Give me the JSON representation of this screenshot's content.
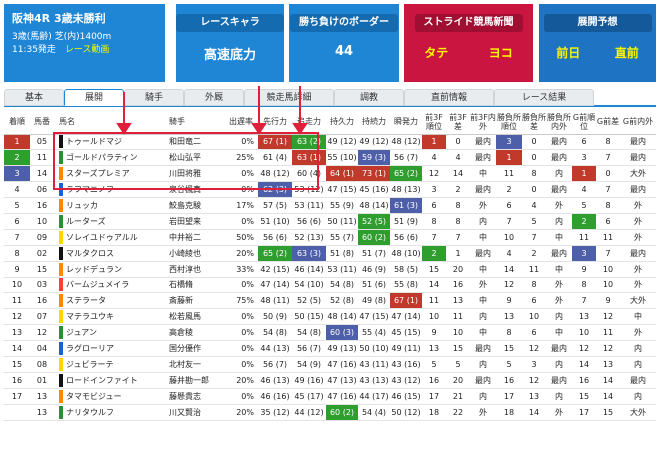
{
  "race": {
    "title": "阪神4R 3歳未勝利",
    "line1": "3歳(馬齢)  芝(内)1400m",
    "post_time": "11:35発走",
    "video": "レース動画"
  },
  "race_chara": {
    "header": "レースキャラ",
    "value": "高速底力"
  },
  "border": {
    "header": "勝ち負けのボーダー",
    "value": "44"
  },
  "stride": {
    "header": "ストライド競馬新聞",
    "left": "タテ",
    "right": "ヨコ"
  },
  "tenkai": {
    "header": "展開予想",
    "left": "前日",
    "right": "直前"
  },
  "tabs": [
    "基本",
    "展開",
    "騎手",
    "外厩",
    "競走馬詳細",
    "調教",
    "直前情報",
    "レース結果"
  ],
  "active_tab": "展開",
  "columns": [
    "着順",
    "馬番",
    "馬名",
    "騎手",
    "出遅率",
    "先行力",
    "追走力",
    "持久力",
    "持続力",
    "瞬発力",
    "前3F順位",
    "前3F差",
    "前3F内外",
    "勝負所順位",
    "勝負所差",
    "勝負所内外",
    "G前順位",
    "G前差",
    "G前内外"
  ],
  "rows": [
    {
      "rank": "1",
      "no": "05",
      "name": "トゥールドマジ",
      "gate": "#111111",
      "jockey": "和田竜二",
      "late": "0%",
      "senko": "67 (1)",
      "tsuiso": "63 (2)",
      "jikyu": "49 (12)",
      "jizoku": "49 (12)",
      "shunpatsu": "48 (12)",
      "f3r": "1",
      "f3d": "0",
      "f3s": "最内",
      "mr": "3",
      "md": "0",
      "ms": "最内",
      "gr": "6",
      "gd": "8",
      "gs": "最内"
    },
    {
      "rank": "2",
      "no": "11",
      "name": "ゴールドパラティン",
      "gate": "#2e8b3c",
      "jockey": "松山弘平",
      "late": "25%",
      "senko": "61 (4)",
      "tsuiso": "63 (1)",
      "jikyu": "55 (10)",
      "jizoku": "59 (3)",
      "shunpatsu": "56 (7)",
      "f3r": "4",
      "f3d": "4",
      "f3s": "最内",
      "mr": "1",
      "md": "0",
      "ms": "最内",
      "gr": "3",
      "gd": "7",
      "gs": "最内"
    },
    {
      "rank": "3",
      "no": "14",
      "name": "スターズプレミア",
      "gate": "#ff8800",
      "jockey": "川田将雅",
      "late": "0%",
      "senko": "48 (12)",
      "tsuiso": "60 (4)",
      "jikyu": "64 (1)",
      "jizoku": "73 (1)",
      "shunpatsu": "65 (2)",
      "f3r": "12",
      "f3d": "14",
      "f3s": "中",
      "mr": "11",
      "md": "8",
      "ms": "内",
      "gr": "1",
      "gd": "0",
      "gs": "大外"
    },
    {
      "rank": "4",
      "no": "06",
      "name": "ラフマニノフ",
      "gate": "#1f5fd6",
      "jockey": "泉谷楓真",
      "late": "0%",
      "senko": "62 (3)",
      "tsuiso": "53 (12)",
      "jikyu": "47 (15)",
      "jizoku": "45 (16)",
      "shunpatsu": "48 (13)",
      "f3r": "3",
      "f3d": "2",
      "f3s": "最内",
      "mr": "2",
      "md": "0",
      "ms": "最内",
      "gr": "4",
      "gd": "7",
      "gs": "最内"
    },
    {
      "rank": "5",
      "no": "16",
      "name": "リュッカ",
      "gate": "#ff8800",
      "jockey": "鮫島克駿",
      "late": "17%",
      "senko": "57 (5)",
      "tsuiso": "53 (11)",
      "jikyu": "55 (9)",
      "jizoku": "48 (14)",
      "shunpatsu": "61 (3)",
      "f3r": "6",
      "f3d": "8",
      "f3s": "外",
      "mr": "6",
      "md": "4",
      "ms": "外",
      "gr": "5",
      "gd": "8",
      "gs": "外"
    },
    {
      "rank": "6",
      "no": "10",
      "name": "ルーターズ",
      "gate": "#2e8b3c",
      "jockey": "岩田望来",
      "late": "0%",
      "senko": "51 (10)",
      "tsuiso": "56 (6)",
      "jikyu": "50 (11)",
      "jizoku": "52 (5)",
      "shunpatsu": "51 (9)",
      "f3r": "8",
      "f3d": "8",
      "f3s": "内",
      "mr": "7",
      "md": "5",
      "ms": "内",
      "gr": "2",
      "gd": "6",
      "gs": "外"
    },
    {
      "rank": "7",
      "no": "09",
      "name": "ソレイユドゥアルル",
      "gate": "#ffd700",
      "jockey": "中井裕二",
      "late": "50%",
      "senko": "56 (6)",
      "tsuiso": "52 (13)",
      "jikyu": "55 (7)",
      "jizoku": "60 (2)",
      "shunpatsu": "56 (6)",
      "f3r": "7",
      "f3d": "7",
      "f3s": "中",
      "mr": "10",
      "md": "7",
      "ms": "中",
      "gr": "11",
      "gd": "11",
      "gs": "外"
    },
    {
      "rank": "8",
      "no": "02",
      "name": "マルタクロス",
      "gate": "#111111",
      "jockey": "小崎綾也",
      "late": "20%",
      "senko": "65 (2)",
      "tsuiso": "63 (3)",
      "jikyu": "51 (8)",
      "jizoku": "51 (7)",
      "shunpatsu": "48 (10)",
      "f3r": "2",
      "f3d": "1",
      "f3s": "最内",
      "mr": "4",
      "md": "2",
      "ms": "最内",
      "gr": "3",
      "gd": "7",
      "gs": "最内"
    },
    {
      "rank": "9",
      "no": "15",
      "name": "レッドデュラン",
      "gate": "#ff8800",
      "jockey": "西村淳也",
      "late": "33%",
      "senko": "42 (15)",
      "tsuiso": "46 (14)",
      "jikyu": "53 (11)",
      "jizoku": "46 (9)",
      "shunpatsu": "58 (5)",
      "f3r": "15",
      "f3d": "20",
      "f3s": "中",
      "mr": "14",
      "md": "11",
      "ms": "中",
      "gr": "9",
      "gd": "10",
      "gs": "外"
    },
    {
      "rank": "10",
      "no": "03",
      "name": "バームジュメイラ",
      "gate": "#ff3b3b",
      "jockey": "石橋脩",
      "late": "0%",
      "senko": "47 (14)",
      "tsuiso": "54 (10)",
      "jikyu": "54 (8)",
      "jizoku": "51 (6)",
      "shunpatsu": "55 (8)",
      "f3r": "14",
      "f3d": "16",
      "f3s": "外",
      "mr": "12",
      "md": "8",
      "ms": "外",
      "gr": "8",
      "gd": "10",
      "gs": "外"
    },
    {
      "rank": "11",
      "no": "16",
      "name": "ステラータ",
      "gate": "#ff8800",
      "jockey": "斎藤新",
      "late": "75%",
      "senko": "48 (11)",
      "tsuiso": "52 (5)",
      "jikyu": "52 (8)",
      "jizoku": "49 (8)",
      "shunpatsu": "67 (1)",
      "f3r": "11",
      "f3d": "13",
      "f3s": "中",
      "mr": "9",
      "md": "6",
      "ms": "外",
      "gr": "7",
      "gd": "9",
      "gs": "大外"
    },
    {
      "rank": "12",
      "no": "07",
      "name": "マテラユウキ",
      "gate": "#ffd700",
      "jockey": "松若風馬",
      "late": "0%",
      "senko": "50 (9)",
      "tsuiso": "50 (15)",
      "jikyu": "48 (14)",
      "jizoku": "47 (15)",
      "shunpatsu": "47 (14)",
      "f3r": "10",
      "f3d": "11",
      "f3s": "内",
      "mr": "13",
      "md": "10",
      "ms": "内",
      "gr": "13",
      "gd": "12",
      "gs": "中"
    },
    {
      "rank": "13",
      "no": "12",
      "name": "ジュアン",
      "gate": "#2e8b3c",
      "jockey": "高倉稜",
      "late": "0%",
      "senko": "54 (8)",
      "tsuiso": "54 (8)",
      "jikyu": "60 (3)",
      "jizoku": "55 (4)",
      "shunpatsu": "45 (15)",
      "f3r": "9",
      "f3d": "10",
      "f3s": "中",
      "mr": "8",
      "md": "6",
      "ms": "中",
      "gr": "10",
      "gd": "11",
      "gs": "外"
    },
    {
      "rank": "14",
      "no": "04",
      "name": "ラグローリア",
      "gate": "#1f5fd6",
      "jockey": "国分優作",
      "late": "0%",
      "senko": "44 (13)",
      "tsuiso": "56 (7)",
      "jikyu": "49 (13)",
      "jizoku": "50 (10)",
      "shunpatsu": "49 (11)",
      "f3r": "13",
      "f3d": "15",
      "f3s": "最内",
      "mr": "15",
      "md": "12",
      "ms": "最内",
      "gr": "12",
      "gd": "12",
      "gs": "内"
    },
    {
      "rank": "15",
      "no": "08",
      "name": "ジュビラーテ",
      "gate": "#ffd700",
      "jockey": "北村友一",
      "late": "0%",
      "senko": "56 (7)",
      "tsuiso": "54 (9)",
      "jikyu": "47 (16)",
      "jizoku": "43 (11)",
      "shunpatsu": "43 (16)",
      "f3r": "5",
      "f3d": "5",
      "f3s": "内",
      "mr": "5",
      "md": "3",
      "ms": "内",
      "gr": "14",
      "gd": "13",
      "gs": "内"
    },
    {
      "rank": "16",
      "no": "01",
      "name": "ロードインファイト",
      "gate": "#111111",
      "jockey": "藤井勘一郎",
      "late": "20%",
      "senko": "46 (13)",
      "tsuiso": "49 (16)",
      "jikyu": "47 (13)",
      "jizoku": "43 (13)",
      "shunpatsu": "43 (12)",
      "f3r": "16",
      "f3d": "20",
      "f3s": "最内",
      "mr": "16",
      "md": "12",
      "ms": "最内",
      "gr": "16",
      "gd": "14",
      "gs": "最内"
    },
    {
      "rank": "17",
      "no": "13",
      "name": "タマモビジュー",
      "gate": "#ff8800",
      "jockey": "藤懸貴志",
      "late": "0%",
      "senko": "46 (16)",
      "tsuiso": "45 (17)",
      "jikyu": "47 (16)",
      "jizoku": "44 (17)",
      "shunpatsu": "46 (15)",
      "f3r": "17",
      "f3d": "21",
      "f3s": "内",
      "mr": "17",
      "md": "13",
      "ms": "内",
      "gr": "15",
      "gd": "14",
      "gs": "内"
    },
    {
      "rank": "",
      "no": "13",
      "name": "ナリタウルフ",
      "gate": "#2e8b3c",
      "jockey": "川又賢治",
      "late": "20%",
      "senko": "35 (12)",
      "tsuiso": "44 (12)",
      "jikyu": "60 (2)",
      "jizoku": "54 (4)",
      "shunpatsu": "50 (12)",
      "f3r": "18",
      "f3d": "22",
      "f3s": "外",
      "mr": "18",
      "md": "14",
      "ms": "外",
      "gr": "17",
      "gd": "15",
      "gs": "大外"
    }
  ],
  "colors": {
    "red": "#c0392b",
    "green": "#2e9e2e",
    "blue": "#4d5fa8",
    "accent": "#1f86d6"
  }
}
